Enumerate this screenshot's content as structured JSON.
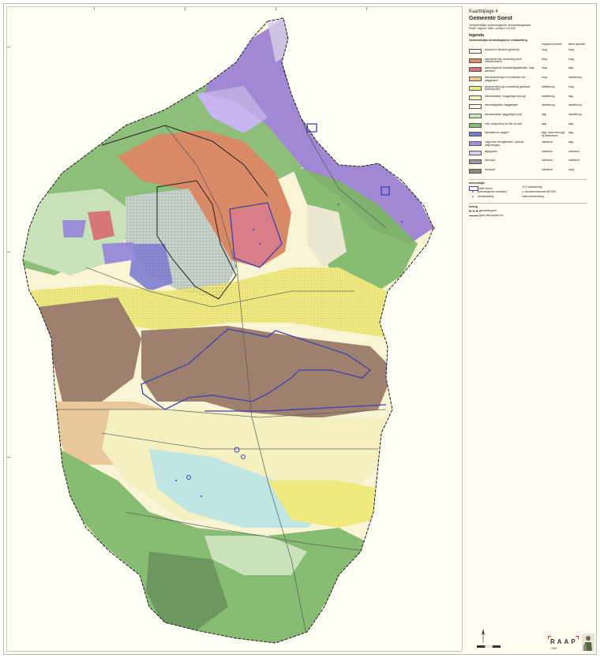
{
  "legend": {
    "kaartbijlage": "Kaartbijlage 4",
    "gemeente": "Gemeente Soest",
    "subtitle_1": "Gemeentelijke archeologische verwachtingskaart",
    "subtitle_2": "RAAP-rapport 1680, schaal 1:15.000",
    "legenda": "legenda",
    "section_heading": "Gemeentelijke archeologische verwachting",
    "col_headers": [
      "",
      "vroegere perioden",
      "latere perioden"
    ],
    "items": [
      {
        "label": "stuwwal en dekzand (gestuwd)",
        "c1": "hoog",
        "c2": "hoog",
        "color": "#f0f0e8"
      },
      {
        "label": "historische kern (bewoning vanaf middeleeuwen)",
        "c1": "hoog",
        "c2": "hoog",
        "color": "#d98b6a"
      },
      {
        "label": "archeologische verwachtingsgebieden, hoge dichtheid",
        "c1": "hoog",
        "c2": "laag",
        "color": "#d4767a"
      },
      {
        "label": "dekzandwelvingen en esdekken met plaggendek",
        "c1": "hoog",
        "c2": "middelhoog",
        "color": "#e9c78f"
      },
      {
        "label": "stuwwal met hoge verwachting (gestuwd bodemprofiel)",
        "c1": "middelhoog",
        "c2": "hoog",
        "color": "#efeb7a"
      },
      {
        "label": "dekzandvlakte, hooggelegen (droog)",
        "c1": "middelhoog",
        "c2": "laag",
        "color": "#f6f2bf"
      },
      {
        "label": "veenrandgebied, laaggelegen",
        "c1": "middelhoog",
        "c2": "middelhoog",
        "color": "#fbfbec"
      },
      {
        "label": "dekzandvlakte, laaggelegen (nat)",
        "c1": "laag",
        "c2": "middelhoog",
        "color": "#c9e7bd"
      },
      {
        "label": "veen (ontgonnen) en klei op veen",
        "c1": "laag",
        "c2": "laag",
        "color": "#86bd73"
      },
      {
        "label": "beekdalen en laagten",
        "c1": "laag, maar verhoogd bij beekoevers",
        "c2": "laag",
        "color": "#7a7ac9"
      },
      {
        "label": "ontgonnen veengebieden, (recente ontginningen)",
        "c1": "onbekend",
        "c2": "laag",
        "color": "#a88ee3"
      },
      {
        "label": "afgegraven",
        "c1": "onbekend",
        "c2": "onbekend",
        "color": "#dcd0f2"
      },
      {
        "label": "bebouwd",
        "c1": "onbekend",
        "c2": "onbekend",
        "color": "#a09aa8"
      },
      {
        "label": "verstoord",
        "c1": "onbekend",
        "c2": "hoog",
        "color": "#8a8a80"
      }
    ],
    "archeologie_heading": "archeologie",
    "archeologie_items": [
      "AMK terrein",
      "archeologische vondst(en)",
      "vondstmelding",
      "waarneming",
      "monumentnummer ARCHIS",
      "onderzoeksmelding"
    ],
    "overig_heading": "overig",
    "overig_items": [
      "gemeentegrens",
      "grens bebouwde kom"
    ],
    "raap_logo": "RAAP",
    "raap_year": "2008"
  },
  "map": {
    "colors": {
      "green": "#7fb56e",
      "light_green": "#c8e2b9",
      "brown": "#a48571",
      "orange": "#d88966",
      "yellow": "#efea7f",
      "pale_yellow": "#f5f0bf",
      "purple": "#a88be0",
      "light_purple": "#d7cbef",
      "blue_boundary": "#3f3fb3",
      "municipal_boundary": "#1e1e1e",
      "light_blue": "#bfe6e3",
      "tan": "#e8c79a"
    }
  }
}
